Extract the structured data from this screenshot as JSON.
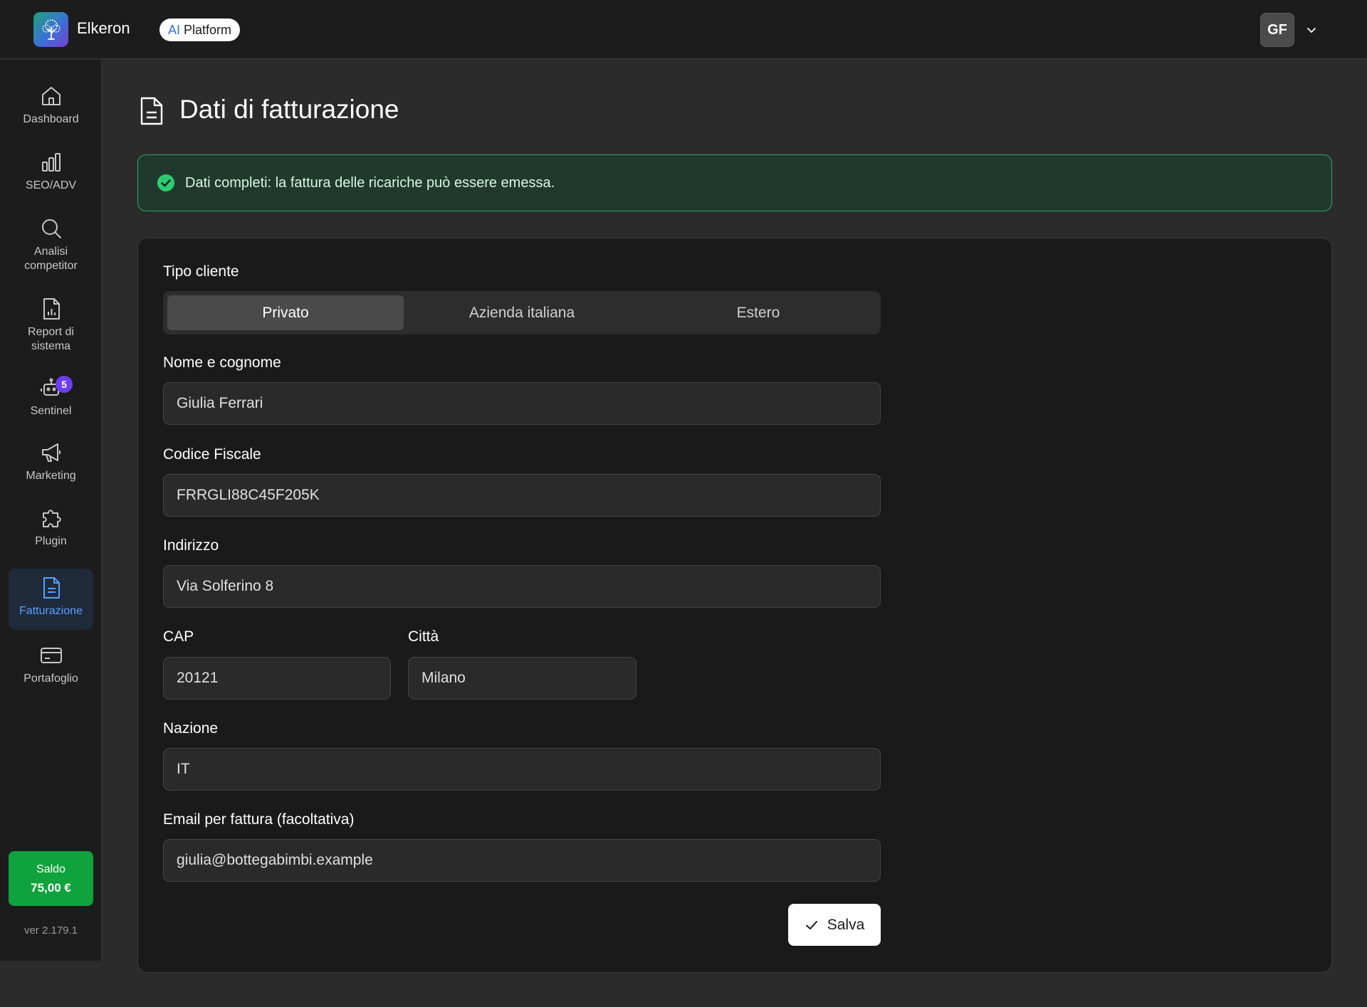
{
  "header": {
    "app_name": "Elkeron",
    "ai_label": "AI",
    "platform_label": "Platform",
    "user_initials": "GF"
  },
  "sidebar": {
    "items": [
      {
        "label": "Dashboard",
        "icon": "home-icon"
      },
      {
        "label": "SEO/ADV",
        "icon": "bar-chart-icon"
      },
      {
        "label": "Analisi competitor",
        "icon": "search-icon"
      },
      {
        "label": "Report di sistema",
        "icon": "report-icon"
      },
      {
        "label": "Sentinel",
        "icon": "robot-icon",
        "badge": "5"
      },
      {
        "label": "Marketing",
        "icon": "megaphone-icon"
      },
      {
        "label": "Plugin",
        "icon": "puzzle-icon"
      },
      {
        "label": "Fatturazione",
        "icon": "invoice-icon",
        "active": true
      },
      {
        "label": "Portafoglio",
        "icon": "wallet-icon"
      }
    ],
    "saldo_label": "Saldo",
    "saldo_amount": "75,00 €",
    "version": "ver 2.179.1"
  },
  "main": {
    "title": "Dati di fatturazione",
    "alert": "Dati completi: la fattura delle ricariche può essere emessa.",
    "form": {
      "tipo_cliente_label": "Tipo cliente",
      "tipo_options": [
        "Privato",
        "Azienda italiana",
        "Estero"
      ],
      "tipo_selected": "Privato",
      "nome_label": "Nome e cognome",
      "nome_value": "Giulia Ferrari",
      "cf_label": "Codice Fiscale",
      "cf_value": "FRRGLI88C45F205K",
      "indirizzo_label": "Indirizzo",
      "indirizzo_value": "Via Solferino 8",
      "cap_label": "CAP",
      "cap_value": "20121",
      "citta_label": "Città",
      "citta_value": "Milano",
      "nazione_label": "Nazione",
      "nazione_value": "IT",
      "email_label": "Email per fattura (facoltativa)",
      "email_value": "giulia@bottegabimbi.example",
      "save_label": "Salva"
    }
  },
  "colors": {
    "accent_blue": "#5aa0ff",
    "success_green": "#2aa56a",
    "saldo_green": "#10a23c",
    "badge_purple": "#6d3df0"
  }
}
